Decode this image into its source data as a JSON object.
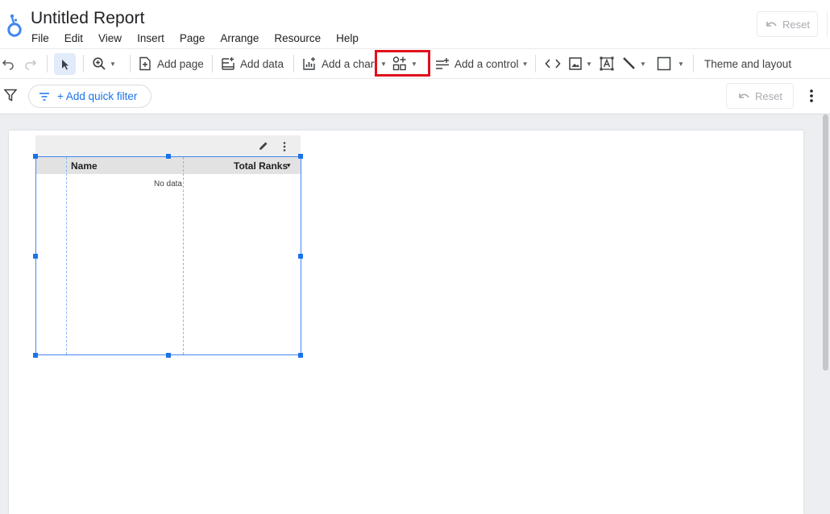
{
  "report": {
    "title": "Untitled Report"
  },
  "menu": [
    "File",
    "Edit",
    "View",
    "Insert",
    "Page",
    "Arrange",
    "Resource",
    "Help"
  ],
  "header": {
    "reset_label": "Reset"
  },
  "toolbar": {
    "add_page_label": "Add page",
    "add_data_label": "Add data",
    "add_chart_label": "Add a chart",
    "add_control_label": "Add a control",
    "theme_layout_label": "Theme and layout"
  },
  "filterbar": {
    "quick_filter_label": "+ Add quick filter",
    "reset_label": "Reset"
  },
  "table": {
    "columns": [
      "Name",
      "Total Ranks"
    ],
    "sort_indicator": "▾",
    "empty_text": "No data"
  },
  "colors": {
    "accent": "#1a73e8",
    "selection_border": "#4285f4",
    "highlight": "#e0111b",
    "select_tool_bg": "#e1ebfa"
  }
}
